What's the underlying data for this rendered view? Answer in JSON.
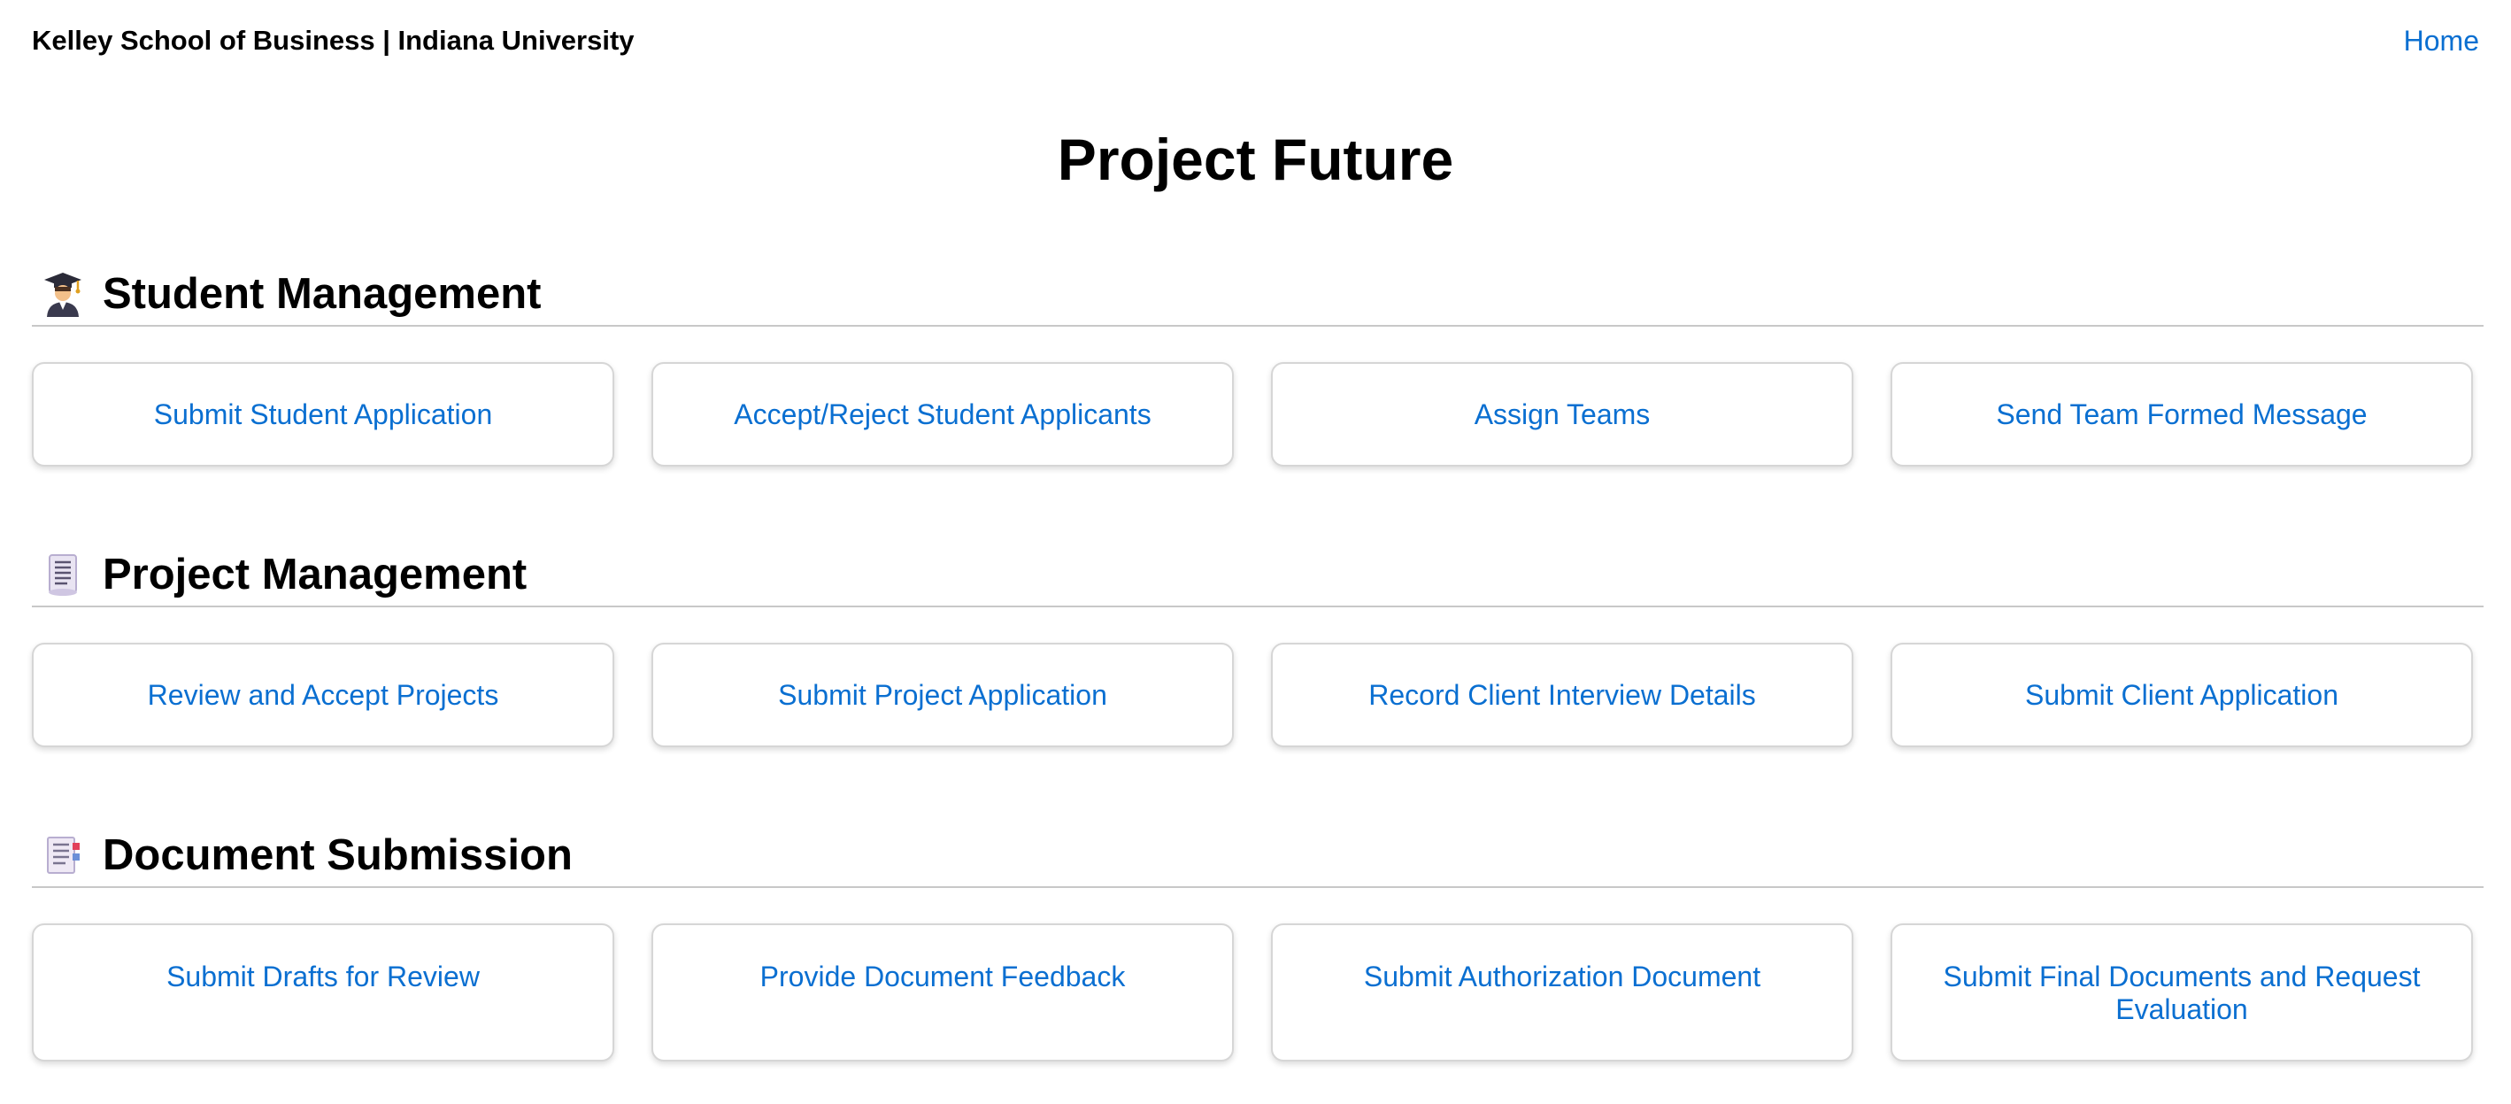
{
  "header": {
    "brand": "Kelley School of Business | Indiana University",
    "home_link": "Home"
  },
  "page": {
    "title": "Project Future"
  },
  "sections": [
    {
      "title": "Student Management",
      "icon": "student-graduate-icon",
      "cards": [
        "Submit Student Application",
        "Accept/Reject Student Applicants",
        "Assign Teams",
        "Send Team Formed Message"
      ]
    },
    {
      "title": "Project Management",
      "icon": "scroll-document-icon",
      "cards": [
        "Review and Accept Projects",
        "Submit Project Application",
        "Record Client Interview Details",
        "Submit Client Application"
      ]
    },
    {
      "title": "Document Submission",
      "icon": "bookmark-tabs-icon",
      "cards": [
        "Submit Drafts for Review",
        "Provide Document Feedback",
        "Submit Authorization Document",
        "Submit Final Documents and Request Evaluation"
      ]
    }
  ],
  "colors": {
    "link": "#0a6fd1",
    "card_border": "#d6d6d6",
    "divider": "#c8c8c8"
  }
}
